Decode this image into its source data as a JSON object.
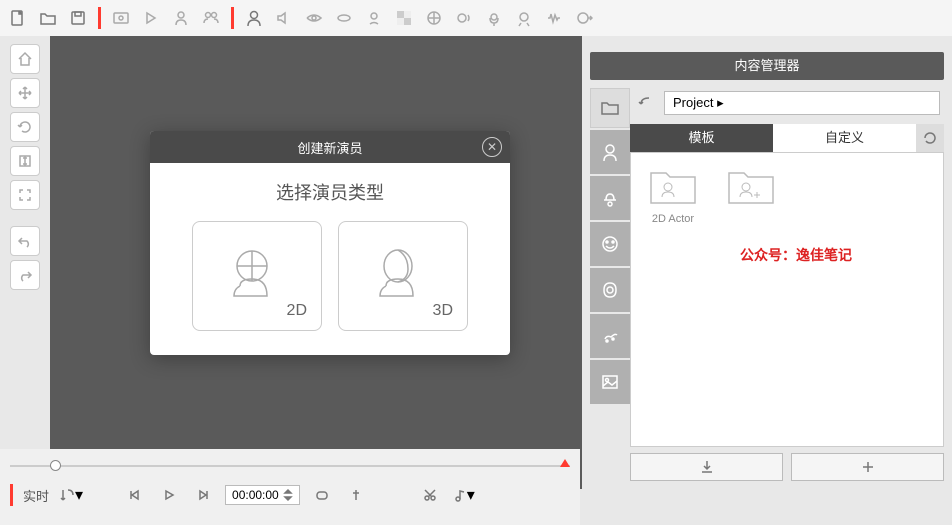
{
  "modal": {
    "title": "创建新演员",
    "subtitle": "选择演员类型",
    "option_2d": "2D",
    "option_3d": "3D"
  },
  "right_panel": {
    "title": "内容管理器",
    "breadcrumb": "Project ▸",
    "tabs": {
      "template": "模板",
      "custom": "自定义"
    },
    "items": [
      {
        "label": "2D Actor"
      }
    ],
    "watermark": "公众号：逸佳笔记"
  },
  "bottom": {
    "mode": "实时",
    "timecode": "00:00:00"
  }
}
